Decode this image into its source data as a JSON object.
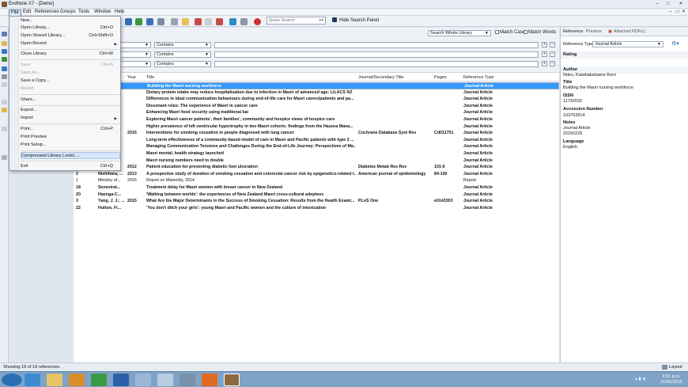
{
  "window": {
    "title": "EndNote X7 - [Demo]",
    "controls": [
      "–",
      "□",
      "✕"
    ]
  },
  "menubar": {
    "items": [
      "File",
      "Edit",
      "References",
      "Groups",
      "Tools",
      "Window",
      "Help"
    ],
    "doc_controls": [
      "–",
      "▭",
      "✕"
    ]
  },
  "toolbar": {
    "quick_search_placeholder": "Quick Search",
    "quick_search_icon": "magnifier-icon",
    "hide_search_panel": "Hide Search Panel"
  },
  "file_menu": {
    "items": [
      {
        "label": "New...",
        "shortcut": ""
      },
      {
        "label": "Open Library...",
        "shortcut": "Ctrl+O"
      },
      {
        "label": "Open Shared Library...",
        "shortcut": "Ctrl+Shift+O"
      },
      {
        "label": "Open Recent",
        "shortcut": ""
      },
      {
        "label": "Close Library",
        "shortcut": "Ctrl+W"
      },
      {
        "label": "Save",
        "shortcut": "Ctrl+S"
      },
      {
        "label": "Save As...",
        "shortcut": ""
      },
      {
        "label": "Save a Copy...",
        "shortcut": ""
      },
      {
        "label": "Revert",
        "shortcut": ""
      },
      {
        "label": "Share...",
        "shortcut": ""
      },
      {
        "label": "Export...",
        "shortcut": ""
      },
      {
        "label": "Import",
        "shortcut": ""
      },
      {
        "label": "Print...",
        "shortcut": "Ctrl+P"
      },
      {
        "label": "Print Preview",
        "shortcut": ""
      },
      {
        "label": "Print Setup...",
        "shortcut": ""
      },
      {
        "label": "Compressed Library (.enlx) ...",
        "shortcut": ""
      },
      {
        "label": "Exit",
        "shortcut": "Ctrl+Q"
      }
    ]
  },
  "search_panel": {
    "scope": "Search Whole Library",
    "match_case": "Match Case",
    "match_words": "Match Words",
    "rows": [
      {
        "condition": "Contains"
      },
      {
        "condition": "Contains"
      },
      {
        "condition": "Contains"
      }
    ]
  },
  "table": {
    "columns": [
      "Year",
      "Title",
      "Journal/Secondary Title",
      "Pages",
      "Reference Type"
    ],
    "rows": [
      {
        "author": "",
        "year": "",
        "title": "Building the Maori nursing workforce",
        "journal": "",
        "pages": "",
        "type": "Journal Article",
        "selected": true,
        "bold": true
      },
      {
        "author": "",
        "year": "",
        "title": "Dietary protein intake may reduce hospitalisation due to infection in Maori of advanced age: LiLACS NZ",
        "journal": "",
        "pages": "",
        "type": "Journal Article",
        "bold": true
      },
      {
        "author": "",
        "year": "",
        "title": "Differences in ideal communication behaviours during end-of-life care for Maori carers/patients and pa...",
        "journal": "",
        "pages": "",
        "type": "Journal Article",
        "bold": true
      },
      {
        "author": "",
        "year": "",
        "title": "Dissonant roles: The experience of Maori in cancer care",
        "journal": "",
        "pages": "",
        "type": "Journal Article",
        "bold": true
      },
      {
        "author": "",
        "year": "",
        "title": "Enhancing Maori food security using traditional kai",
        "journal": "",
        "pages": "",
        "type": "Journal Article",
        "bold": true
      },
      {
        "author": "",
        "year": "",
        "title": "Exploring Maori cancer patients', their families', community and hospice views of hospice care",
        "journal": "",
        "pages": "",
        "type": "Journal Article",
        "bold": true
      },
      {
        "author": "",
        "year": "",
        "title": "Higher prevalence of left ventricular hypertrophy in two Maori cohorts: findings from the Hauora Mana...",
        "journal": "",
        "pages": "",
        "type": "Journal Article",
        "bold": true
      },
      {
        "author": "",
        "year": "2015",
        "title": "Interventions for smoking cessation in people diagnosed with lung cancer",
        "journal": "Cochrane Database Syst Rev",
        "pages": "Cd011751",
        "type": "Journal Article",
        "bold": true
      },
      {
        "author": "",
        "year": "",
        "title": "Long-term effectiveness of a community-based model of care in Maori and Pacific patients with type 2 ...",
        "journal": "",
        "pages": "",
        "type": "Journal Article",
        "bold": true
      },
      {
        "author": "",
        "year": "",
        "title": "Managing Communication Tensions and Challenges During the End-of-Life Journey: Perspectives of Ma...",
        "journal": "",
        "pages": "",
        "type": "Journal Article",
        "bold": true
      },
      {
        "author": "",
        "year": "",
        "title": "Maori mental, health strategy launched",
        "journal": "",
        "pages": "",
        "type": "Journal Article",
        "bold": true
      },
      {
        "author": "",
        "year": "",
        "title": "Maori nursing numbers need to double",
        "journal": "",
        "pages": "",
        "type": "Journal Article",
        "bold": true
      },
      {
        "author": "",
        "year": "2012",
        "title": "Patient education for preventing diabetic foot ulceration",
        "journal": "Diabetes Metab Res Rev",
        "pages": "101-6",
        "type": "Journal Article",
        "bold": true
      },
      {
        "author": "Nishihara, ...",
        "year": "2013",
        "title": "A prospective study of duration of smoking cessation and colorectal cancer risk by epigenetics-related t...",
        "journal": "American journal of epidemiology",
        "pages": "84-100",
        "type": "Journal Article",
        "bold": true,
        "num": "2"
      },
      {
        "author": "Ministry of...",
        "year": "2015",
        "title": "Report on Maternity, 2014",
        "journal": "",
        "pages": "",
        "type": "Report",
        "bold": false,
        "num": "1"
      },
      {
        "author": "Senevirat...",
        "year": "",
        "title": "Treatment delay for Maori women with breast cancer in New Zealand",
        "journal": "",
        "pages": "",
        "type": "Journal Article",
        "bold": true,
        "num": "18"
      },
      {
        "author": "Haenga-C...",
        "year": "",
        "title": "'Walking between worlds': the experiences of New Zealand Maori cross-cultural adoptees",
        "journal": "",
        "pages": "",
        "type": "Journal Article",
        "bold": true,
        "num": "20"
      },
      {
        "author": "Yang, J. J.; ...",
        "year": "2015",
        "title": "What Are the Major Determinants in the Success of Smoking Cessation: Results from the Health Exami...",
        "journal": "PLoS One",
        "pages": "e0143303",
        "type": "Journal Article",
        "bold": true,
        "num": "3"
      },
      {
        "author": "Hutton, Fi...",
        "year": "",
        "title": "'You don't ditch your girls': young Maori and Pacific women and the culture of intoxication",
        "journal": "",
        "pages": "",
        "type": "Journal Article",
        "bold": true,
        "num": "22"
      }
    ]
  },
  "right_panel": {
    "tabs": [
      "Reference",
      "Preview",
      "Attached PDFs"
    ],
    "reference_type_label": "Reference Type:",
    "reference_type": "Journal Article",
    "fields": [
      {
        "label": "Rating",
        "value": ""
      },
      {
        "label": "Author",
        "value": "Noku, Kaiwhakahaere Kerri"
      },
      {
        "label": "Title",
        "value": "Building the Maori nursing workforce"
      },
      {
        "label": "ISSN",
        "value": "11732032"
      },
      {
        "label": "Accession Number",
        "value": "103763914"
      },
      {
        "label": "Notes",
        "value": "Journal Article\n20150226"
      },
      {
        "label": "Language",
        "value": "English"
      }
    ]
  },
  "status": {
    "text": "Showing 19 of 19 references.",
    "layout": "Layout"
  },
  "taskbar": {
    "time": "4:01 p.m.",
    "date": "21/01/2016"
  },
  "colors": {
    "selection": "#3399ff",
    "menu_highlight": "#d7e6f8",
    "taskbar": "#7fa3c6"
  }
}
